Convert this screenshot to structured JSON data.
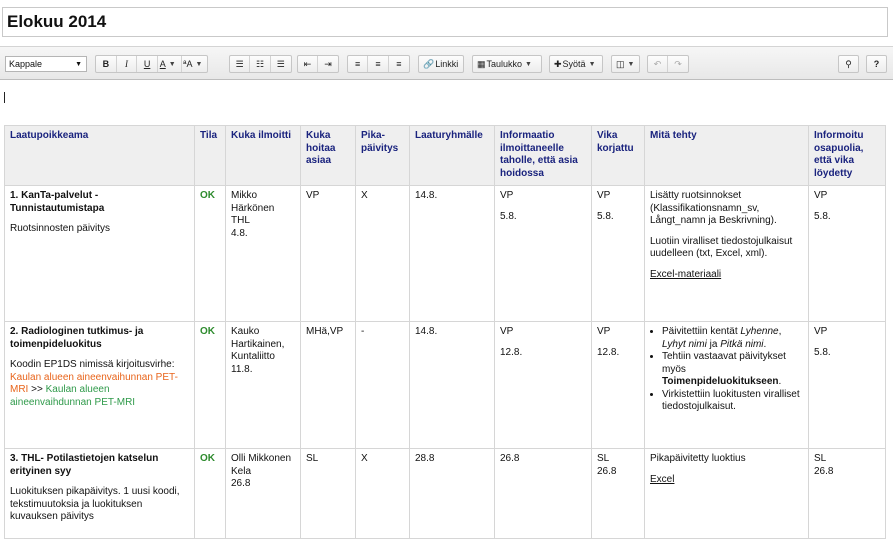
{
  "page": {
    "title": "Elokuu 2014"
  },
  "toolbar": {
    "paragraph_style": "Kappale",
    "bold": "B",
    "italic": "I",
    "underline": "U",
    "text_color": "A",
    "text_size": "ªA",
    "link": "Linkki",
    "table": "Taulukko",
    "insert": "Syötä"
  },
  "table": {
    "headers": [
      "Laatupoikkeama",
      "Tila",
      "Kuka ilmoitti",
      "Kuka hoitaa asiaa",
      "Pika-päivitys",
      "Laaturyhmälle",
      "Informaatio ilmoittaneelle taholle, että asia hoidossa",
      "Vika korjattu",
      "Mitä tehty",
      "Informoitu osapuolia, että vika löydetty"
    ],
    "rows": [
      {
        "title": "1. KanTa-palvelut - Tunnistautumistapa",
        "desc": "Ruotsinnosten päivitys",
        "status": "OK",
        "reporter": [
          "Mikko",
          "Härkönen",
          "THL",
          "4.8."
        ],
        "handler": "VP",
        "quick": "X",
        "group": "14.8.",
        "info": [
          "VP",
          "5.8."
        ],
        "fixed": [
          "VP",
          "5.8."
        ],
        "done_1": "Lisätty ruotsinnokset (Klassifikationsnamn_sv, Långt_namn ja Beskrivning).",
        "done_2": "Luotiin viralliset tiedostojulkaisut uudelleen (txt, Excel, xml).",
        "done_link": "Excel-materiaali",
        "informed": [
          "VP",
          "5.8."
        ]
      },
      {
        "title": "2. Radiologinen tutkimus- ja toimenpideluokitus",
        "desc": "Koodin EP1DS nimissä kirjoitusvirhe:",
        "wrong": "Kaulan alueen aineenvaihunnan PET-MRI",
        "arrow": ">>",
        "right": "Kaulan alueen aineenvaihdunnan PET-MRI",
        "status": "OK",
        "reporter": [
          "Kauko",
          "Hartikainen,",
          "Kuntaliitto",
          "11.8."
        ],
        "handler": "MHä,VP",
        "quick": "-",
        "group": "14.8.",
        "info": [
          "VP",
          "12.8."
        ],
        "fixed": [
          "VP",
          "12.8."
        ],
        "b1_pre": "Päivitettiin kentät ",
        "b1_it1": "Lyhenne",
        "b1_sep1": ", ",
        "b1_it2": "Lyhyt nimi",
        "b1_sep2": " ja ",
        "b1_it3": "Pitkä nimi",
        "b1_end": ".",
        "b2_pre": "Tehtiin vastaavat päivitykset myös ",
        "b2_bold": "Toimenpideluokitukseen",
        "b2_end": ".",
        "b3": "Virkistettiin luokitusten viralliset tiedostojulkaisut.",
        "informed": [
          "VP",
          "5.8."
        ]
      },
      {
        "title": "3. THL- Potilastietojen katselun erityinen syy",
        "desc": "Luokituksen pikapäivitys. 1 uusi koodi, tekstimuutoksia ja luokituksen kuvauksen päivitys",
        "status": "OK",
        "reporter": [
          "Olli Mikkonen",
          "Kela",
          "26.8"
        ],
        "handler": "SL",
        "quick": "X",
        "group": "28.8",
        "info": "26.8",
        "fixed": [
          "SL",
          "26.8"
        ],
        "done_1": "Pikapäivitetty luoktius",
        "done_link": "Excel",
        "informed": [
          "SL",
          "26.8"
        ]
      }
    ]
  }
}
